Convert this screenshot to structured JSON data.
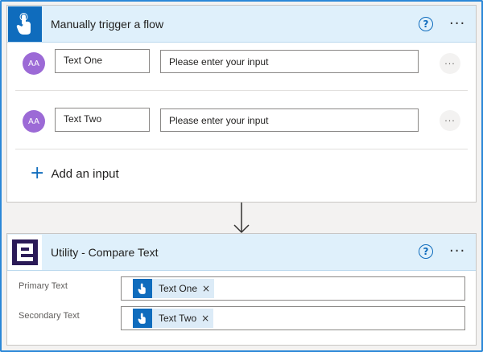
{
  "trigger_card": {
    "title": "Manually trigger a flow",
    "help_glyph": "?",
    "more_glyph": "···",
    "inputs": [
      {
        "avatar_text": "AA",
        "name": "Text One",
        "value_placeholder": "Please enter your input",
        "more_glyph": "···"
      },
      {
        "avatar_text": "AA",
        "name": "Text Two",
        "value_placeholder": "Please enter your input",
        "more_glyph": "···"
      }
    ],
    "add_input_icon": "+",
    "add_input_label": "Add an input"
  },
  "action_card": {
    "title": "Utility - Compare Text",
    "help_glyph": "?",
    "more_glyph": "···",
    "params": [
      {
        "label": "Primary Text",
        "token": "Text One",
        "remove_glyph": "×"
      },
      {
        "label": "Secondary Text",
        "token": "Text Two",
        "remove_glyph": "×"
      }
    ]
  },
  "icons": {
    "trigger": "hand-tap-icon",
    "utility": "utility-logo-icon",
    "connector": "arrow-down-icon"
  },
  "colors": {
    "accent": "#0f6cbd",
    "header_bg": "#dff0fb",
    "avatar": "#9c6ad6",
    "utility_logo": "#2b1a57",
    "token_bg": "#dcebf7",
    "frame": "#2b88d8"
  }
}
